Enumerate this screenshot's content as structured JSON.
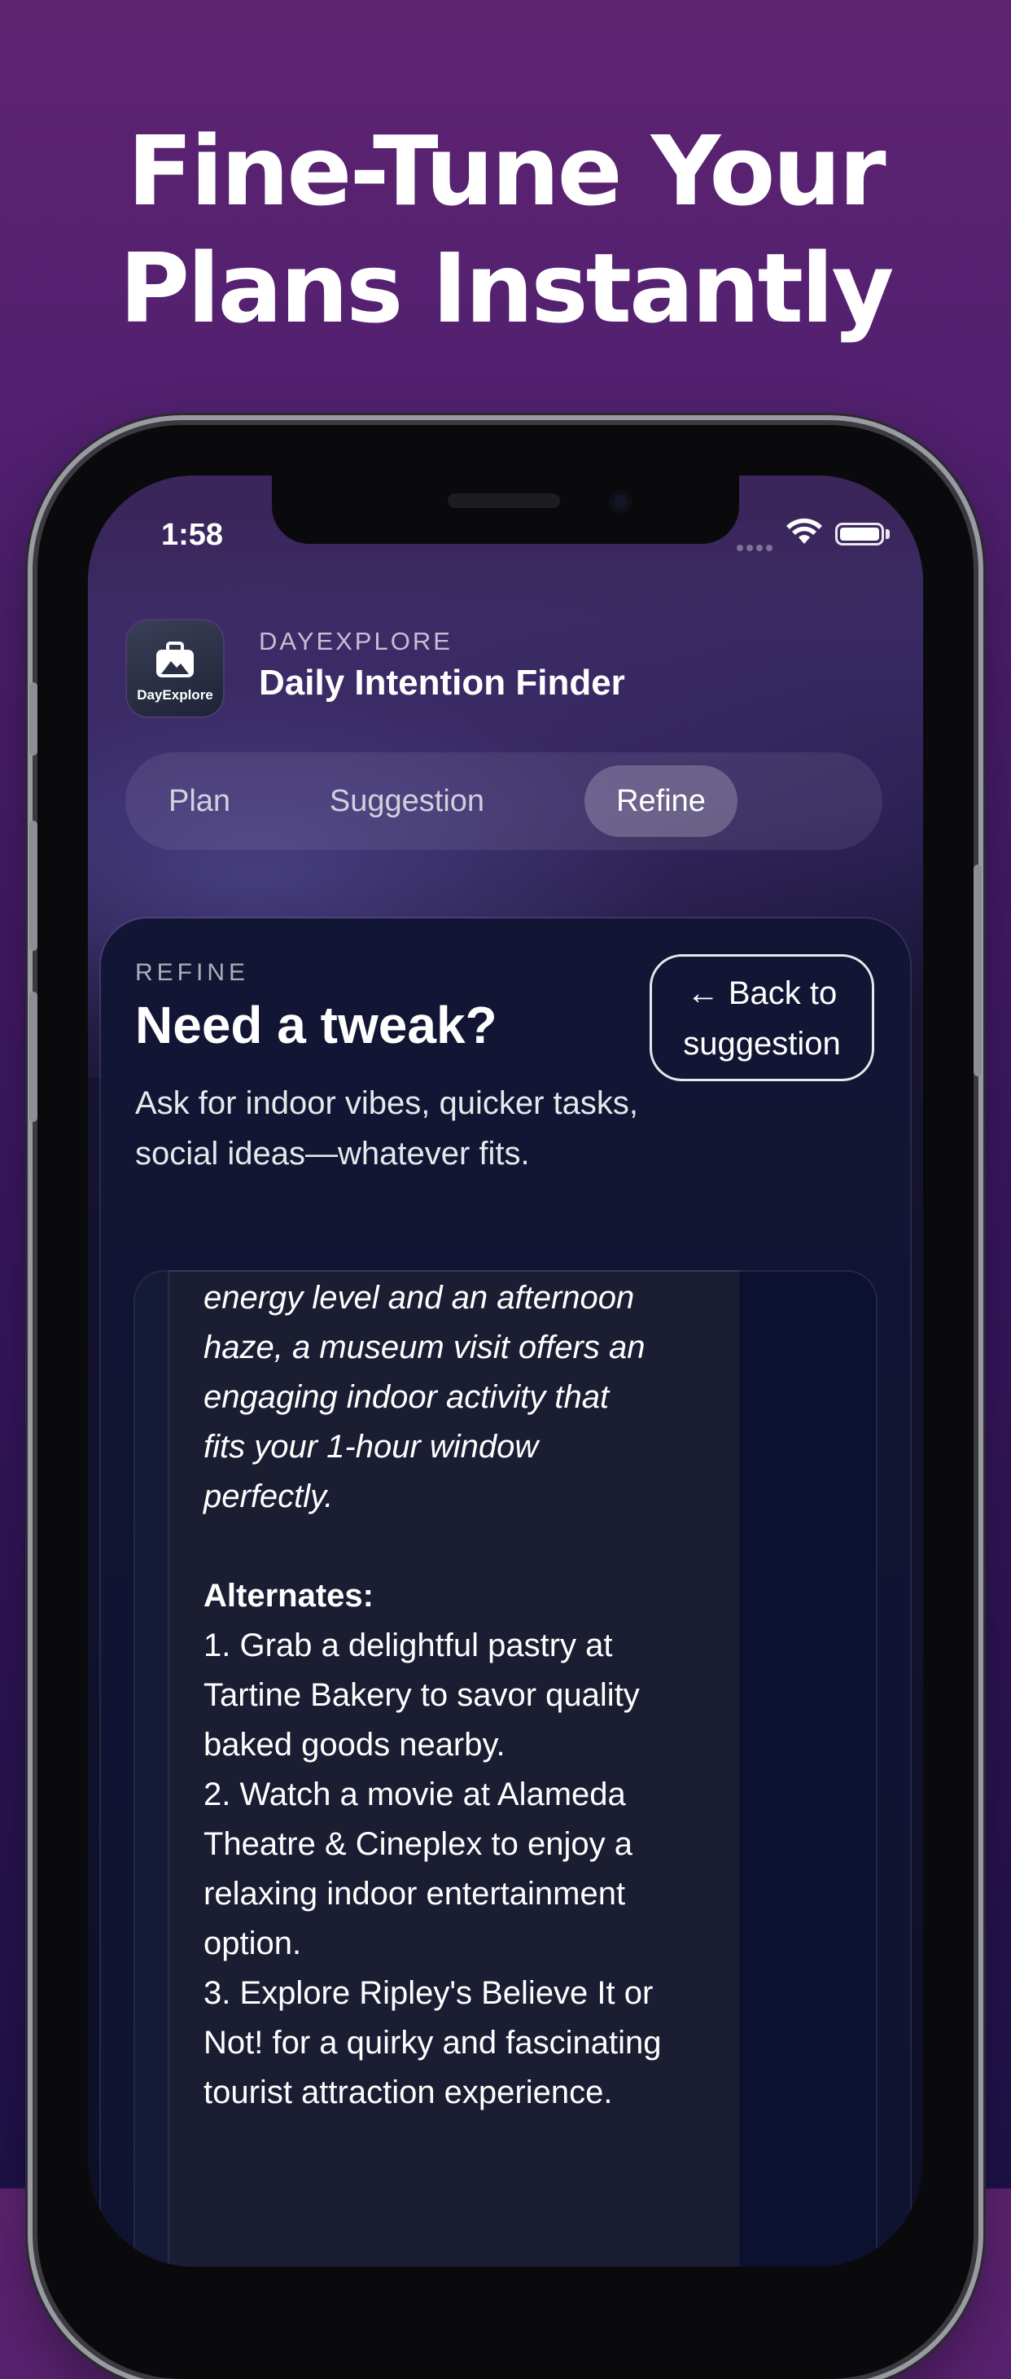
{
  "headline": {
    "line1": "Fine-Tune Your",
    "line2": "Plans Instantly"
  },
  "status_bar": {
    "time": "1:58"
  },
  "app": {
    "logo_text": "DayExplore",
    "kicker": "DAYEXPLORE",
    "title": "Daily Intention Finder"
  },
  "tabs": [
    {
      "label": "Plan",
      "active": false
    },
    {
      "label": "Suggestion",
      "active": false
    },
    {
      "label": "Refine",
      "active": true
    }
  ],
  "refine_card": {
    "kicker": "REFINE",
    "title": "Need a tweak?",
    "description": "Ask for indoor vibes, quicker tasks, social ideas—whatever fits.",
    "back_button_arrow": "←",
    "back_button_label": "Back to suggestion"
  },
  "message": {
    "reason_lines": [
      "energy level and an afternoon",
      "haze, a museum visit offers an",
      "engaging indoor activity that",
      "fits your 1-hour window",
      "perfectly."
    ],
    "alternates_heading": "Alternates:",
    "alternates": [
      "1. Grab a delightful pastry at Tartine Bakery to savor quality baked goods nearby.",
      "2. Watch a movie at Alameda Theatre & Cineplex to enjoy a relaxing indoor entertainment option.",
      "3. Explore Ripley's Believe It or Not! for a quirky and fascinating tourist attraction experience."
    ]
  },
  "colors": {
    "background_top": "#5e2472",
    "background_bottom": "#1e1248",
    "card_bg": "#121634",
    "active_tab": "rgba(255,255,255,0.22)"
  }
}
